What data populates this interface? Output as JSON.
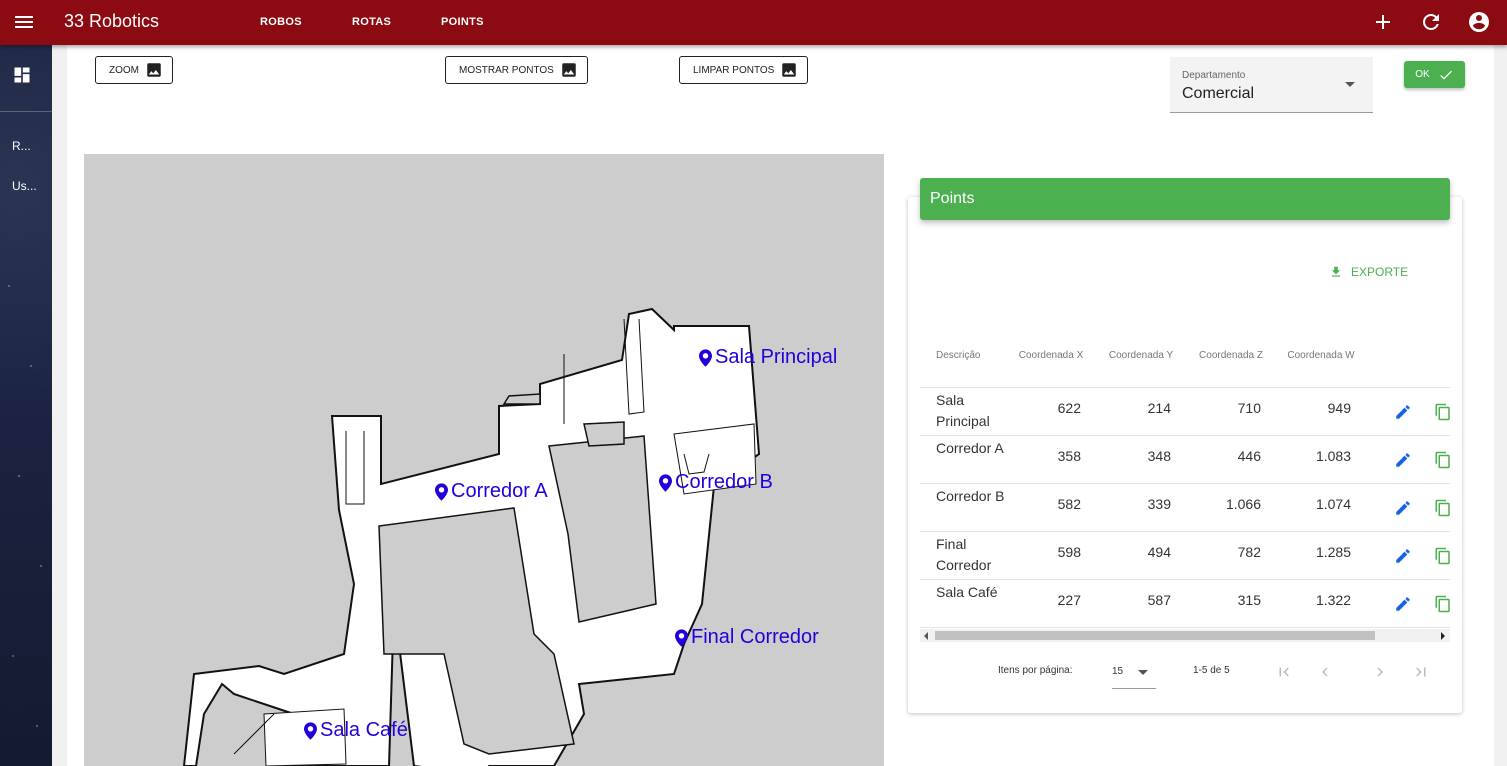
{
  "app": {
    "title": "33 Robotics"
  },
  "nav": {
    "items": [
      "ROBOS",
      "ROTAS",
      "POINTS"
    ]
  },
  "sidebar": {
    "items": [
      "R...",
      "Us..."
    ]
  },
  "toolbar": {
    "zoom_label": "ZOOM",
    "show_points_label": "MOSTRAR PONTOS",
    "clear_points_label": "LIMPAR PONTOS",
    "ok_label": "OK"
  },
  "department": {
    "label": "Departamento",
    "value": "Comercial"
  },
  "map": {
    "markers": [
      "Sala Principal",
      "Corredor A",
      "Corredor B",
      "Final Corredor",
      "Sala Café"
    ]
  },
  "points": {
    "title": "Points",
    "export_label": "EXPORTE",
    "columns": [
      "Descrição",
      "Coordenada X",
      "Coordenada Y",
      "Coordenada Z",
      "Coordenada W"
    ],
    "rows": [
      {
        "desc": "Sala Principal",
        "x": "622",
        "y": "214",
        "z": "710",
        "w": "949"
      },
      {
        "desc": "Corredor A",
        "x": "358",
        "y": "348",
        "z": "446",
        "w": "1.083"
      },
      {
        "desc": "Corredor B",
        "x": "582",
        "y": "339",
        "z": "1.066",
        "w": "1.074"
      },
      {
        "desc": "Final Corredor",
        "x": "598",
        "y": "494",
        "z": "782",
        "w": "1.285"
      },
      {
        "desc": "Sala Café",
        "x": "227",
        "y": "587",
        "z": "315",
        "w": "1.322"
      }
    ],
    "paginator": {
      "items_label": "Itens por página:",
      "page_size": "15",
      "range_label": "1-5 de 5"
    }
  },
  "colors": {
    "topbar": "#8c0a12",
    "accent": "#4caf50",
    "marker": "#2200dd"
  },
  "icons": [
    "menu-icon",
    "add-icon",
    "refresh-icon",
    "account-icon",
    "dashboard-icon",
    "image-icon",
    "check-icon",
    "download-icon",
    "edit-icon",
    "copy-icon",
    "map-marker-icon"
  ]
}
